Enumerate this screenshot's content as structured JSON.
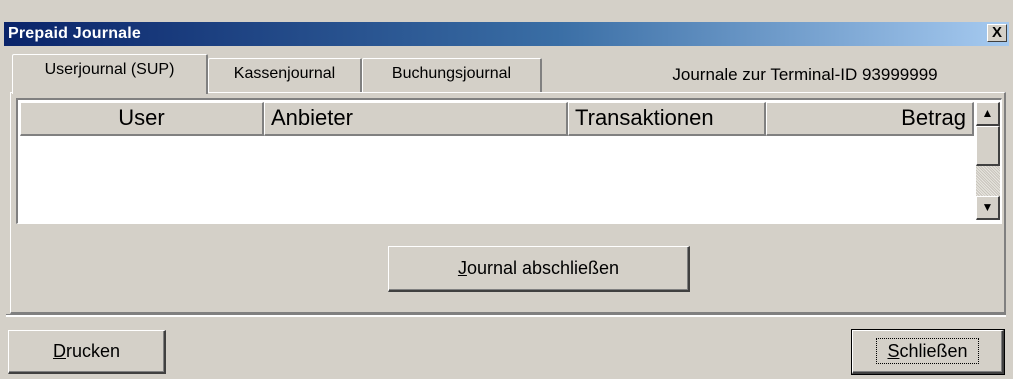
{
  "window": {
    "title": "Prepaid Journale",
    "close_glyph": "X"
  },
  "tabs": [
    {
      "label": "Userjournal (SUP)",
      "active": true
    },
    {
      "label": "Kassenjournal",
      "active": false
    },
    {
      "label": "Buchungsjournal",
      "active": false
    }
  ],
  "terminal_info": "Journale zur Terminal-ID 93999999",
  "table": {
    "columns": [
      "User",
      "Anbieter",
      "Transaktionen",
      "Betrag"
    ],
    "rows": []
  },
  "buttons": {
    "journal_close": {
      "mnemonic": "J",
      "rest": "ournal abschließen"
    },
    "print": {
      "mnemonic": "D",
      "rest": "rucken"
    },
    "close": {
      "mnemonic": "S",
      "rest": "chließen"
    }
  },
  "icons": {
    "scroll_up": "▲",
    "scroll_down": "▼"
  }
}
